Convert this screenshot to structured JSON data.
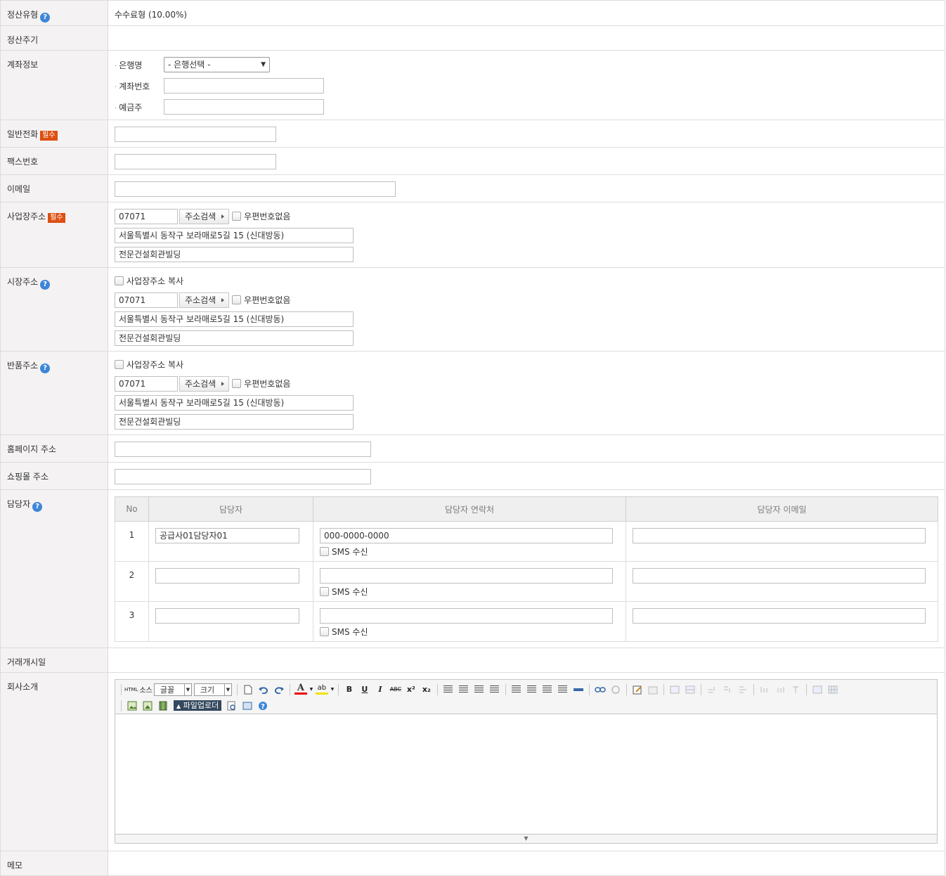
{
  "labels": {
    "settle_type": "정산유형",
    "settle_cycle": "정산주기",
    "account_info": "계좌정보",
    "phone": "일반전화",
    "fax": "팩스번호",
    "email": "이메일",
    "biz_address": "사업장주소",
    "market_address": "시장주소",
    "return_address": "반품주소",
    "homepage": "홈페이지 주소",
    "shop": "쇼핑몰 주소",
    "manager": "담당자",
    "trade_start": "거래개시일",
    "company_intro": "회사소개",
    "memo": "메모",
    "required": "필수",
    "help": "?"
  },
  "settle_type_value": "수수료형 (10.00%)",
  "account": {
    "bank_label": "은행명",
    "bank_select": "- 은행선택 -",
    "number_label": "계좌번호",
    "holder_label": "예금주",
    "bullet": "·"
  },
  "address_common": {
    "search_button": "주소검색",
    "no_zip_label": "우편번호없음",
    "copy_label": "사업장주소 복사"
  },
  "biz_address": {
    "zip": "07071",
    "line1": "서울특별시 동작구 보라매로5길 15 (신대방동)",
    "line2": "전문건설회관빌딩"
  },
  "market_address": {
    "zip": "07071",
    "line1": "서울특별시 동작구 보라매로5길 15 (신대방동)",
    "line2": "전문건설회관빌딩"
  },
  "return_address": {
    "zip": "07071",
    "line1": "서울특별시 동작구 보라매로5길 15 (신대방동)",
    "line2": "전문건설회관빌딩"
  },
  "manager_table": {
    "headers": [
      "No",
      "담당자",
      "담당자 연락처",
      "담당자 이메일"
    ],
    "sms_label": "SMS 수신",
    "rows": [
      {
        "no": "1",
        "name": "공급사01담당자01",
        "phone": "000-0000-0000",
        "email": ""
      },
      {
        "no": "2",
        "name": "",
        "phone": "",
        "email": ""
      },
      {
        "no": "3",
        "name": "",
        "phone": "",
        "email": ""
      }
    ]
  },
  "editor": {
    "html_label": "HTML",
    "source_label": "소스",
    "font_label": "글꼴",
    "size_label": "크기",
    "upload_label": "파일업로더",
    "bold": "B",
    "underline": "U",
    "italic": "I",
    "strike": "ABC",
    "sup": "x²",
    "sub": "x₂",
    "font_color": "A",
    "highlight": "ab",
    "resize_glyph": "▼"
  }
}
